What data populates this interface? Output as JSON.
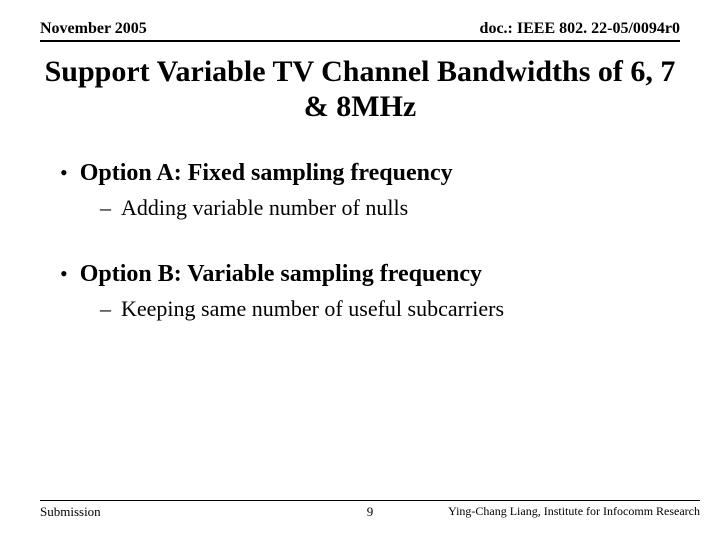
{
  "header": {
    "date": "November 2005",
    "doc_id": "doc.: IEEE 802. 22-05/0094r0"
  },
  "title": "Support Variable TV Channel Bandwidths of 6, 7 & 8MHz",
  "options": [
    {
      "label": "Option A: Fixed sampling frequency",
      "sub": "Adding variable number of nulls"
    },
    {
      "label": "Option B: Variable sampling frequency",
      "sub": "Keeping same number of useful subcarriers"
    }
  ],
  "footer": {
    "left": "Submission",
    "page": "9",
    "right": "Ying-Chang Liang, Institute for Infocomm Research"
  }
}
